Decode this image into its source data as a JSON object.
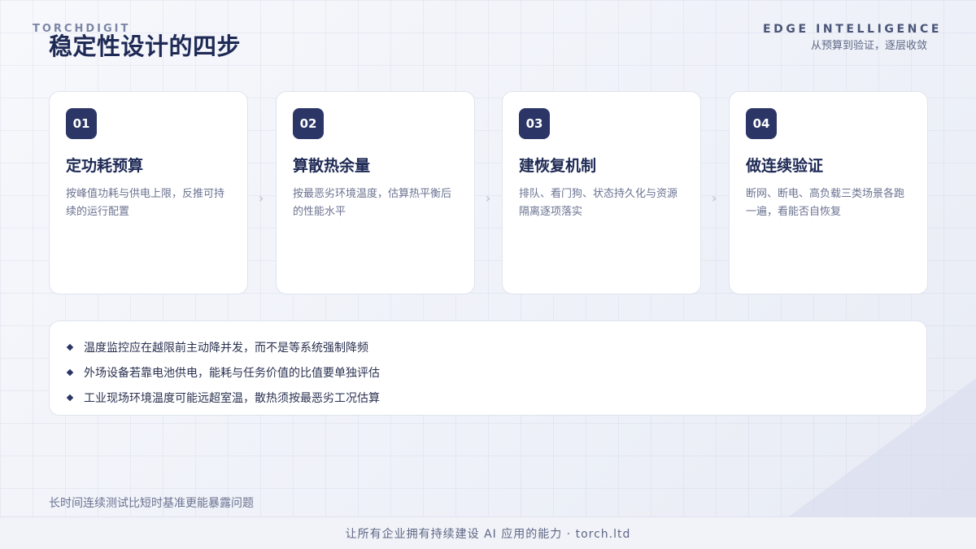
{
  "brand": "TORCHDIGIT",
  "title": "稳定性设计的四步",
  "header_right": {
    "title": "EDGE INTELLIGENCE",
    "subtitle": "从预算到验证，逐层收敛"
  },
  "steps": [
    {
      "num": "01",
      "title": "定功耗预算",
      "desc": "按峰值功耗与供电上限，反推可持续的运行配置"
    },
    {
      "num": "02",
      "title": "算散热余量",
      "desc": "按最恶劣环境温度，估算热平衡后的性能水平"
    },
    {
      "num": "03",
      "title": "建恢复机制",
      "desc": "排队、看门狗、状态持久化与资源隔离逐项落实"
    },
    {
      "num": "04",
      "title": "做连续验证",
      "desc": "断网、断电、高负载三类场景各跑一遍，看能否自恢复"
    }
  ],
  "arrow_glyph": "›",
  "notes": [
    "温度监控应在越限前主动降并发，而不是等系统强制降频",
    "外场设备若靠电池供电，能耗与任务价值的比值要单独评估",
    "工业现场环境温度可能远超室温，散热须按最恶劣工况估算"
  ],
  "footnote": "长时间连续测试比短时基准更能暴露问题",
  "footer": "让所有企业拥有持续建设 AI 应用的能力 · torch.ltd",
  "colors": {
    "accent": "#2b3566",
    "title": "#1e2a55",
    "muted": "#6b7391"
  }
}
